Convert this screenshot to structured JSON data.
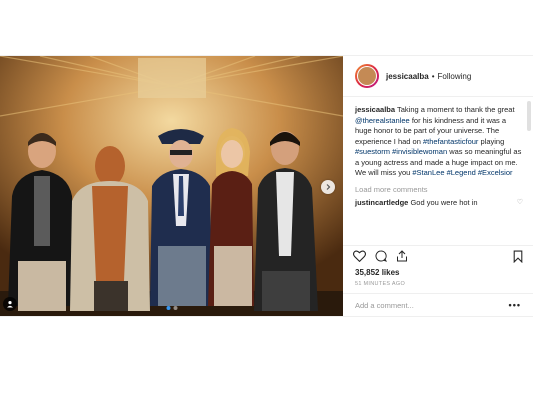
{
  "post": {
    "username": "jessicaalba",
    "separator": "•",
    "follow_status": "Following",
    "caption": {
      "username": "jessicaalba",
      "text_1": " Taking a moment to thank the great ",
      "mention": "@therealstanlee",
      "text_2": " for his kindness and it was a huge honor to be part of your universe. The experience I had on ",
      "tag_1": "#thefantasticfour",
      "text_3": " playing ",
      "tag_2": "#suestorm",
      "text_4": " ",
      "tag_3": "#invisiblewoman",
      "text_5": " was so meaningful as a young actress and made a huge impact on me. We will miss you ",
      "tag_4": "#StanLee",
      "text_6": " ",
      "tag_5": "#Legend",
      "text_7": " ",
      "tag_6": "#Excelsior"
    },
    "load_more": "Load more comments",
    "comment": {
      "username": "justincartledge",
      "text": " God you were hot in"
    },
    "likes": "35,852 likes",
    "timestamp": "51 MINUTES AGO",
    "add_comment_placeholder": "Add a comment...",
    "more_label": "•••"
  },
  "carousel": {
    "slide_count": 2,
    "active_slide": 1
  },
  "colors": {
    "link": "#003569",
    "dot_active": "#3897f0",
    "muted": "#999999",
    "text": "#262626"
  },
  "icons": [
    "user-tag-icon",
    "chevron-right-icon",
    "heart-icon",
    "comment-icon",
    "share-icon",
    "bookmark-icon",
    "small-heart-icon",
    "more-options-icon"
  ]
}
